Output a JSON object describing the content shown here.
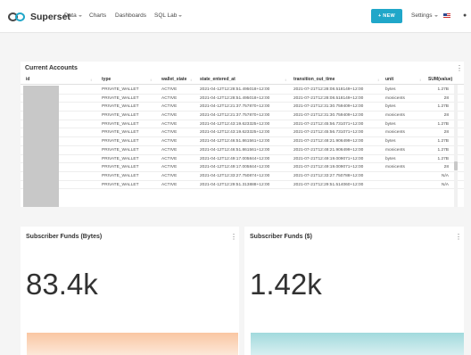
{
  "nav": {
    "brand": "Superset",
    "menus": [
      {
        "label": "Data",
        "has_caret": true
      },
      {
        "label": "Charts",
        "has_caret": false
      },
      {
        "label": "Dashboards",
        "has_caret": false
      },
      {
        "label": "SQL Lab",
        "has_caret": true
      }
    ],
    "new_button": "+ NEW",
    "settings": "Settings",
    "accent_color": "#20a7c9"
  },
  "table": {
    "title": "Current Accounts",
    "columns": [
      "id",
      "type",
      "wallet_state",
      "state_entered_at",
      "transition_out_time",
      "unit",
      "SUM(value)"
    ],
    "rows": [
      [
        "",
        "PRIVATE_WALLET",
        "ACTIVE",
        "2021-04-12T12:28:51.495018+12:00",
        "2021-07-21T12:28:08.518149+12:00",
        "bytes",
        "1.27B"
      ],
      [
        "",
        "PRIVATE_WALLET",
        "ACTIVE",
        "2021-04-12T12:28:51.495018+12:00",
        "2021-07-21T12:28:08.518149+12:00",
        "monicents",
        "28"
      ],
      [
        "",
        "PRIVATE_WALLET",
        "ACTIVE",
        "2021-04-12T12:21:37.757870+12:00",
        "2021-07-21T12:31:30.759409+12:00",
        "bytes",
        "1.27B"
      ],
      [
        "",
        "PRIVATE_WALLET",
        "ACTIVE",
        "2021-04-12T12:21:37.757870+12:00",
        "2021-07-21T12:31:30.759409+12:00",
        "monicents",
        "28"
      ],
      [
        "",
        "PRIVATE_WALLET",
        "ACTIVE",
        "2021-04-12T12:43:19.623325+12:00",
        "2021-07-21T12:45:56.731071+12:00",
        "bytes",
        "1.27B"
      ],
      [
        "",
        "PRIVATE_WALLET",
        "ACTIVE",
        "2021-04-12T12:43:19.623325+12:00",
        "2021-07-21T12:45:56.731071+12:00",
        "monicents",
        "28"
      ],
      [
        "",
        "PRIVATE_WALLET",
        "ACTIVE",
        "2021-04-12T12:46:51.861561+12:00",
        "2021-07-21T12:48:21.906499+12:00",
        "bytes",
        "1.27B"
      ],
      [
        "",
        "PRIVATE_WALLET",
        "ACTIVE",
        "2021-04-12T12:46:51.861561+12:00",
        "2021-07-21T12:48:21.906499+12:00",
        "monicents",
        "1.27B"
      ],
      [
        "",
        "PRIVATE_WALLET",
        "ACTIVE",
        "2021-04-12T12:49:17.005844+12:00",
        "2021-07-21T12:49:19.009071+12:00",
        "bytes",
        "1.27B"
      ],
      [
        "",
        "PRIVATE_WALLET",
        "ACTIVE",
        "2021-04-12T12:49:17.005844+12:00",
        "2021-07-21T12:49:19.009071+12:00",
        "monicents",
        "28"
      ],
      [
        "",
        "PRIVATE_WALLET",
        "ACTIVE",
        "2021-04-12T12:33:27.750874+12:00",
        "2021-07-21T12:33:27.750788+12:00",
        "",
        "N/A"
      ],
      [
        "",
        "PRIVATE_WALLET",
        "ACTIVE",
        "2021-04-12T12:29:51.313888+12:00",
        "2021-07-21T12:29:51.514060+12:00",
        "",
        "N/A"
      ]
    ]
  },
  "bignumbers": [
    {
      "title": "Subscriber Funds (Bytes)",
      "value": "83.4k",
      "trend_color": "#f8b88b"
    },
    {
      "title": "Subscriber Funds ($)",
      "value": "1.42k",
      "trend_color": "#8ad0d4"
    }
  ]
}
